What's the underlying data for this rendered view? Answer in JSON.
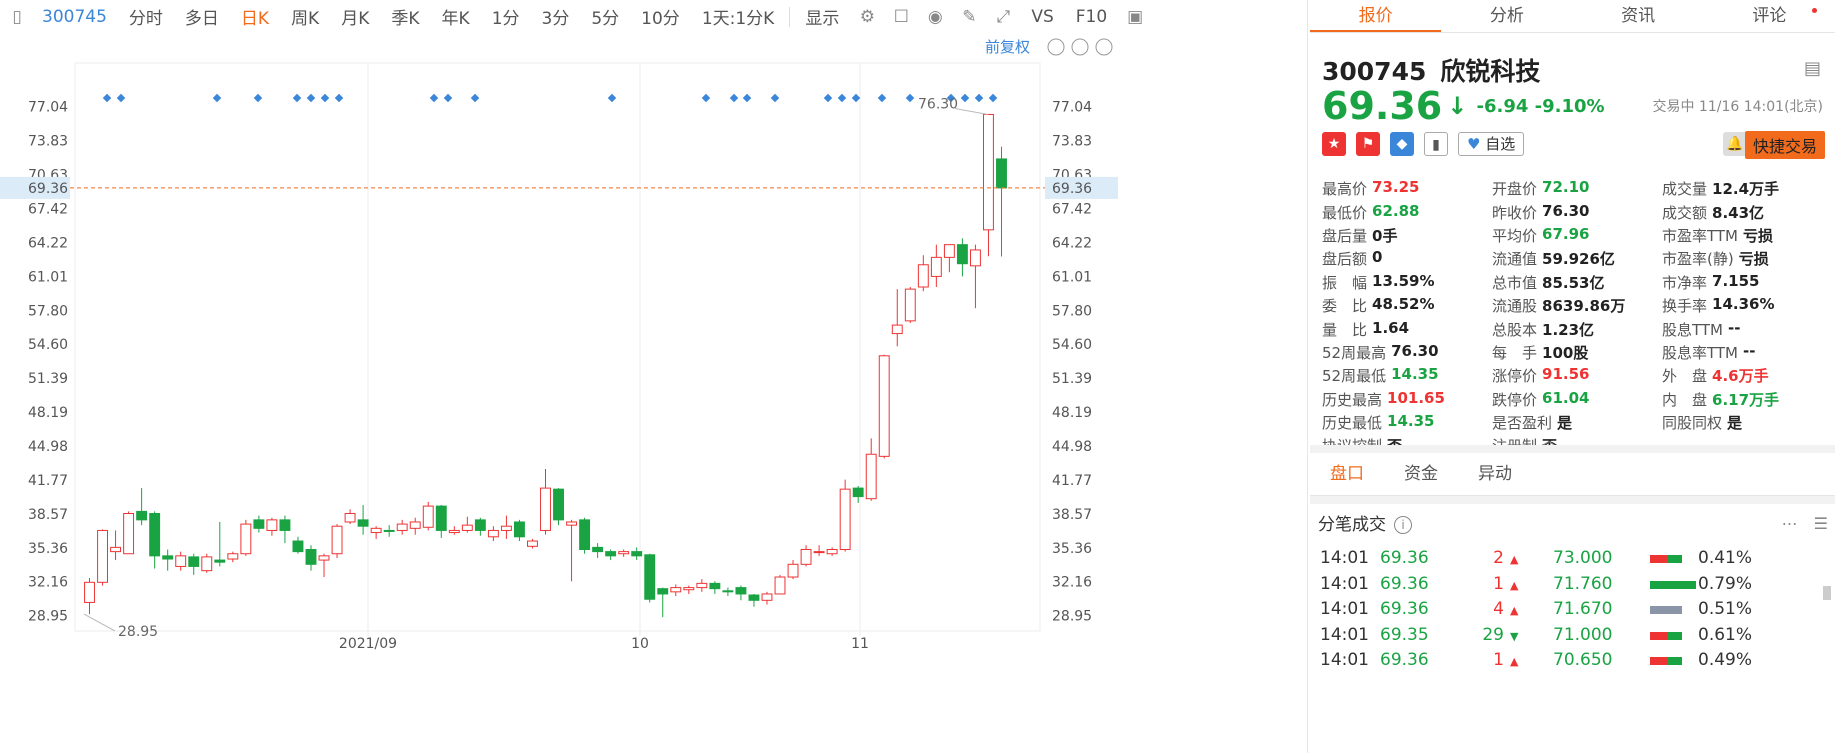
{
  "toolbar": {
    "code": "300745",
    "items": [
      "分时",
      "多日",
      "日K",
      "周K",
      "月K",
      "季K",
      "年K",
      "1分",
      "3分",
      "5分",
      "10分",
      "1天:1分K",
      "显示",
      "VS",
      "F10"
    ],
    "active": "日K"
  },
  "chart": {
    "fq": "前复权",
    "ylabels": [
      "77.04",
      "73.83",
      "70.63",
      "67.42",
      "64.22",
      "61.01",
      "57.80",
      "54.60",
      "51.39",
      "48.19",
      "44.98",
      "41.77",
      "38.57",
      "35.36",
      "32.16",
      "28.95"
    ],
    "xlabels": [
      "2021/09",
      "10",
      "11"
    ],
    "current": "69.36",
    "max_label": "76.30",
    "min_label": "28.95"
  },
  "chart_data": {
    "type": "candlestick",
    "ylim": [
      27.5,
      78.8
    ],
    "current": 69.36,
    "candles": [
      [
        30.2,
        32.1,
        29.1,
        32.5
      ],
      [
        32.1,
        37.0,
        31.8,
        37.1
      ],
      [
        35.0,
        35.4,
        34.2,
        37.0
      ],
      [
        34.8,
        38.6,
        34.8,
        38.8
      ],
      [
        38.8,
        38.0,
        37.5,
        41.0
      ],
      [
        38.6,
        34.6,
        33.4,
        38.8
      ],
      [
        34.6,
        34.3,
        33.2,
        35.2
      ],
      [
        33.6,
        34.6,
        33.2,
        35.0
      ],
      [
        34.5,
        33.6,
        32.8,
        34.8
      ],
      [
        33.2,
        34.5,
        33.0,
        34.8
      ],
      [
        34.2,
        34.0,
        33.6,
        37.8
      ],
      [
        34.3,
        34.8,
        34.0,
        35.0
      ],
      [
        34.8,
        37.6,
        34.6,
        38.0
      ],
      [
        38.0,
        37.2,
        36.8,
        38.4
      ],
      [
        37.0,
        38.0,
        36.5,
        38.2
      ],
      [
        38.0,
        37.0,
        35.8,
        38.4
      ],
      [
        36.0,
        35.0,
        34.8,
        36.4
      ],
      [
        35.2,
        33.8,
        33.2,
        35.6
      ],
      [
        34.2,
        34.6,
        32.6,
        34.8
      ],
      [
        34.8,
        37.4,
        34.4,
        37.6
      ],
      [
        37.8,
        38.6,
        37.6,
        39.0
      ],
      [
        38.0,
        37.4,
        36.6,
        39.4
      ],
      [
        36.8,
        37.2,
        36.2,
        37.4
      ],
      [
        37.0,
        36.9,
        36.4,
        37.5
      ],
      [
        37.0,
        37.6,
        36.6,
        38.0
      ],
      [
        37.2,
        37.8,
        36.6,
        38.2
      ],
      [
        37.3,
        39.3,
        37.0,
        39.7
      ],
      [
        39.3,
        37.0,
        36.3,
        39.4
      ],
      [
        36.8,
        37.0,
        36.6,
        37.4
      ],
      [
        37.0,
        37.5,
        36.8,
        38.3
      ],
      [
        38.0,
        37.0,
        36.5,
        38.2
      ],
      [
        36.4,
        37.0,
        36.0,
        37.4
      ],
      [
        37.0,
        37.4,
        36.2,
        38.4
      ],
      [
        37.8,
        36.4,
        36.0,
        38.0
      ],
      [
        35.5,
        36.0,
        35.3,
        36.2
      ],
      [
        37.0,
        41.0,
        36.6,
        42.8
      ],
      [
        40.9,
        38.0,
        37.5,
        41.0
      ],
      [
        37.5,
        37.8,
        32.2,
        38.0
      ],
      [
        38.0,
        35.2,
        34.8,
        38.2
      ],
      [
        35.4,
        35.0,
        34.4,
        35.8
      ],
      [
        35.0,
        34.6,
        34.2,
        35.2
      ],
      [
        34.8,
        35.0,
        34.5,
        35.2
      ],
      [
        35.0,
        34.6,
        34.2,
        35.4
      ],
      [
        34.7,
        30.5,
        30.2,
        34.8
      ],
      [
        31.5,
        31.0,
        28.8,
        31.6
      ],
      [
        31.2,
        31.6,
        30.8,
        31.9
      ],
      [
        31.4,
        31.6,
        31.0,
        31.8
      ],
      [
        31.6,
        32.0,
        31.2,
        32.4
      ],
      [
        32.0,
        31.5,
        31.0,
        32.2
      ],
      [
        31.3,
        31.2,
        30.8,
        31.6
      ],
      [
        31.6,
        31.0,
        30.4,
        31.8
      ],
      [
        30.9,
        30.4,
        29.8,
        31.0
      ],
      [
        30.4,
        31.0,
        30.0,
        31.2
      ],
      [
        31.0,
        32.6,
        31.0,
        32.8
      ],
      [
        32.6,
        33.8,
        32.4,
        34.2
      ],
      [
        33.8,
        35.2,
        33.6,
        35.6
      ],
      [
        35.0,
        35.0,
        34.6,
        35.6
      ],
      [
        34.8,
        35.2,
        34.6,
        35.4
      ],
      [
        35.2,
        40.9,
        35.0,
        41.8
      ],
      [
        41.0,
        40.2,
        39.6,
        41.2
      ],
      [
        40.0,
        44.2,
        39.8,
        45.7
      ],
      [
        44.0,
        53.5,
        43.8,
        53.6
      ],
      [
        55.6,
        56.4,
        54.4,
        59.8
      ],
      [
        56.8,
        59.8,
        56.6,
        60.0
      ],
      [
        60.0,
        62.1,
        59.6,
        63.0
      ],
      [
        61.0,
        62.8,
        60.0,
        64.0
      ],
      [
        62.8,
        64.0,
        61.4,
        64.0
      ],
      [
        64.0,
        62.2,
        61.0,
        64.6
      ],
      [
        62.0,
        63.5,
        58.0,
        64.0
      ],
      [
        65.4,
        76.3,
        62.9,
        76.3
      ],
      [
        72.1,
        69.36,
        62.88,
        73.25
      ]
    ]
  },
  "quote": {
    "tabs": [
      "报价",
      "分析",
      "资讯",
      "评论"
    ],
    "code": "300745",
    "name": "欣锐科技",
    "price": "69.36",
    "change": "-6.94",
    "pct": "-9.10%",
    "trading_time": "交易中 11/16 14:01(北京)",
    "zixuan": "自选",
    "quick": "快捷交易",
    "stats": [
      [
        [
          "最高价",
          "73.25",
          "up"
        ],
        [
          "开盘价",
          "72.10",
          "dn"
        ],
        [
          "成交量",
          "12.4万手",
          ""
        ]
      ],
      [
        [
          "最低价",
          "62.88",
          "dn"
        ],
        [
          "昨收价",
          "76.30",
          ""
        ],
        [
          "成交额",
          "8.43亿",
          ""
        ]
      ],
      [
        [
          "盘后量",
          "0手",
          ""
        ],
        [
          "平均价",
          "67.96",
          "dn"
        ],
        [
          "市盈率TTM",
          "亏损",
          ""
        ]
      ],
      [
        [
          "盘后额",
          "0",
          ""
        ],
        [
          "流通值",
          "59.926亿",
          ""
        ],
        [
          "市盈率(静)",
          "亏损",
          ""
        ]
      ],
      [
        [
          "振　幅",
          "13.59%",
          ""
        ],
        [
          "总市值",
          "85.53亿",
          ""
        ],
        [
          "市净率",
          "7.155",
          ""
        ]
      ],
      [
        [
          "委　比",
          "48.52%",
          ""
        ],
        [
          "流通股",
          "8639.86万",
          ""
        ],
        [
          "换手率",
          "14.36%",
          ""
        ]
      ],
      [
        [
          "量　比",
          "1.64",
          ""
        ],
        [
          "总股本",
          "1.23亿",
          ""
        ],
        [
          "股息TTM",
          "--",
          ""
        ]
      ],
      [
        [
          "52周最高",
          "76.30",
          ""
        ],
        [
          "每　手",
          "100股",
          ""
        ],
        [
          "股息率TTM",
          "--",
          ""
        ]
      ],
      [
        [
          "52周最低",
          "14.35",
          "dn"
        ],
        [
          "涨停价",
          "91.56",
          "up"
        ],
        [
          "外　盘",
          "4.6万手",
          "up"
        ]
      ],
      [
        [
          "历史最高",
          "101.65",
          "up"
        ],
        [
          "跌停价",
          "61.04",
          "dn"
        ],
        [
          "内　盘",
          "6.17万手",
          "dn"
        ]
      ],
      [
        [
          "历史最低",
          "14.35",
          "dn"
        ],
        [
          "是否盈利",
          "是",
          ""
        ],
        [
          "同股同权",
          "是",
          ""
        ]
      ],
      [
        [
          "协议控制",
          "否",
          ""
        ],
        [
          "注册制",
          "否",
          ""
        ],
        [
          "",
          "",
          " "
        ]
      ]
    ],
    "subtabs": [
      "盘口",
      "资金",
      "异动"
    ],
    "tick_title": "分笔成交",
    "ticks": [
      {
        "time": "14:01",
        "price": "69.36",
        "vol": "2",
        "dir": "up",
        "bid": "73.000",
        "pct": "0.41%",
        "bar": "rg"
      },
      {
        "time": "14:01",
        "price": "69.36",
        "vol": "1",
        "dir": "up",
        "bid": "71.760",
        "pct": "0.79%",
        "bar": "g"
      },
      {
        "time": "14:01",
        "price": "69.36",
        "vol": "4",
        "dir": "up",
        "bid": "71.670",
        "pct": "0.51%",
        "bar": "gray"
      },
      {
        "time": "14:01",
        "price": "69.35",
        "vol": "29",
        "dir": "dn",
        "bid": "71.000",
        "pct": "0.61%",
        "bar": "rg"
      },
      {
        "time": "14:01",
        "price": "69.36",
        "vol": "1",
        "dir": "up",
        "bid": "70.650",
        "pct": "0.49%",
        "bar": "rg"
      }
    ]
  }
}
